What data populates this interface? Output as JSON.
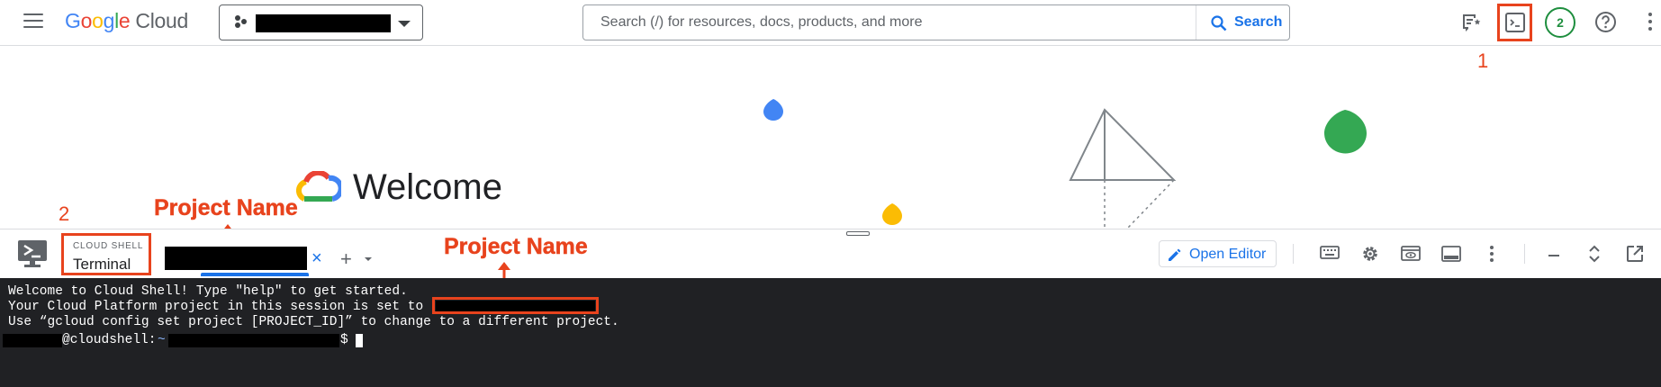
{
  "header": {
    "logo_google": [
      "G",
      "o",
      "o",
      "g",
      "l",
      "e"
    ],
    "logo_product": "Cloud",
    "search": {
      "placeholder": "Search (/) for resources, docs, products, and more",
      "button_label": "Search"
    },
    "notifications_count": "2"
  },
  "welcome": {
    "title": "Welcome"
  },
  "annotations": {
    "marker_1": "1",
    "marker_2": "2",
    "project_name_label": "Project Name"
  },
  "cloud_shell": {
    "eyebrow": "CLOUD SHELL",
    "title": "Terminal",
    "tab_close": "×",
    "add_tab": "+",
    "open_editor_label": "Open Editor"
  },
  "terminal": {
    "lines": [
      "Welcome to Cloud Shell! Type \"help\" to get started.",
      "Your Cloud Platform project in this session is set to",
      "Use “gcloud config set project [PROJECT_ID]” to change to a different project."
    ],
    "prompt_host": "@cloudshell:",
    "prompt_path": "~",
    "prompt_symbol": "$"
  },
  "colors": {
    "accent_blue": "#1a73e8",
    "annotation_red": "#e8431d",
    "terminal_bg": "#202124",
    "badge_green": "#1e8e3e"
  },
  "icons": [
    "menu-icon",
    "project-dots-icon",
    "search-icon",
    "notes-icon",
    "cloud-shell-icon",
    "help-icon",
    "more-vert-icon",
    "gcp-logo-icon",
    "terminal-logo-icon",
    "pencil-icon",
    "keyboard-icon",
    "settings-icon",
    "web-preview-icon",
    "panel-icon",
    "minimize-icon",
    "restore-icon",
    "open-new-window-icon"
  ]
}
